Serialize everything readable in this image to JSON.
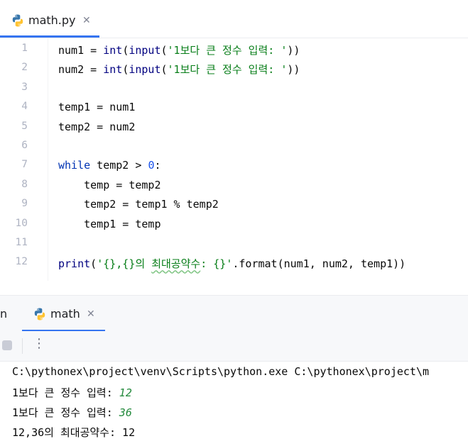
{
  "editor_tab": {
    "label": "math.py",
    "icon": "python-icon"
  },
  "code_lines": [
    {
      "no": "1",
      "tokens": [
        {
          "t": "num1 = "
        },
        {
          "t": "int",
          "c": "bi"
        },
        {
          "t": "("
        },
        {
          "t": "input",
          "c": "bi"
        },
        {
          "t": "("
        },
        {
          "t": "'1보다 큰 정수 입력: '",
          "c": "str"
        },
        {
          "t": "))"
        }
      ]
    },
    {
      "no": "2",
      "tokens": [
        {
          "t": "num2 = "
        },
        {
          "t": "int",
          "c": "bi"
        },
        {
          "t": "("
        },
        {
          "t": "input",
          "c": "bi"
        },
        {
          "t": "("
        },
        {
          "t": "'1보다 큰 정수 입력: '",
          "c": "str"
        },
        {
          "t": "))"
        }
      ]
    },
    {
      "no": "3",
      "tokens": []
    },
    {
      "no": "4",
      "tokens": [
        {
          "t": "temp1 = num1"
        }
      ]
    },
    {
      "no": "5",
      "tokens": [
        {
          "t": "temp2 = num2"
        }
      ]
    },
    {
      "no": "6",
      "tokens": []
    },
    {
      "no": "7",
      "tokens": [
        {
          "t": "while",
          "c": "kw"
        },
        {
          "t": " temp2 > "
        },
        {
          "t": "0",
          "c": "num"
        },
        {
          "t": ":"
        }
      ]
    },
    {
      "no": "8",
      "tokens": [
        {
          "t": "    temp = temp2"
        }
      ]
    },
    {
      "no": "9",
      "tokens": [
        {
          "t": "    temp2 = temp1 % temp2"
        }
      ]
    },
    {
      "no": "10",
      "tokens": [
        {
          "t": "    temp1 = temp"
        }
      ]
    },
    {
      "no": "11",
      "tokens": []
    },
    {
      "no": "12",
      "tokens": [
        {
          "t": "print",
          "c": "bi"
        },
        {
          "t": "("
        },
        {
          "t": "'{},{}의 ",
          "c": "str"
        },
        {
          "t": "최대공약수",
          "c": "str squiggle"
        },
        {
          "t": ": {}'",
          "c": "str"
        },
        {
          "t": ".format(num1, num2, temp1))"
        }
      ]
    }
  ],
  "run_panel": {
    "title_fragment": "n",
    "tab_label": "math",
    "tab_icon": "python-icon"
  },
  "console": {
    "command": "C:\\pythonex\\project\\venv\\Scripts\\python.exe C:\\pythonex\\project\\m",
    "prompt1": "1보다 큰 정수 입력: ",
    "input1": "12",
    "prompt2": "1보다 큰 정수 입력: ",
    "input2": "36",
    "result": "12,36의 최대공약수: 12"
  },
  "colors": {
    "accent": "#3574f0",
    "keyword": "#0033b3",
    "string": "#067d17",
    "number": "#1750eb",
    "console_input": "#248a3d"
  }
}
